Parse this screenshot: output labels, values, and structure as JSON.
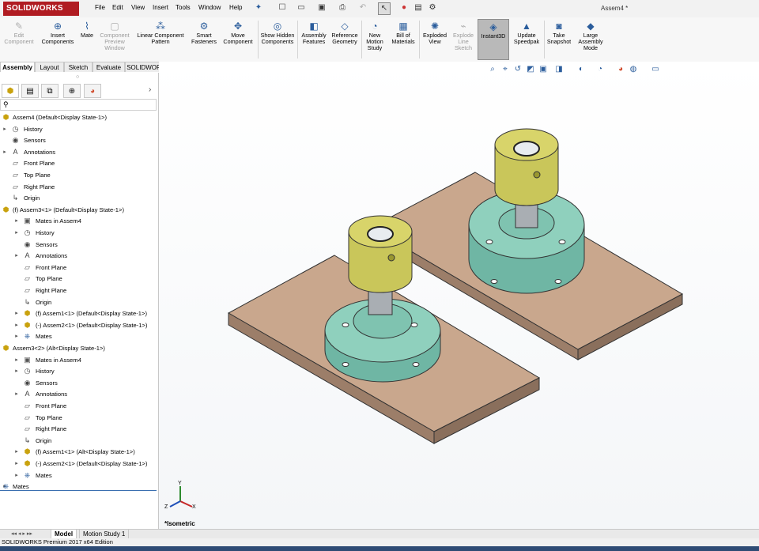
{
  "app": {
    "logo": "SOLIDWORKS",
    "document_title": "Assem4 *"
  },
  "menu": [
    "File",
    "Edit",
    "View",
    "Insert",
    "Tools",
    "Window",
    "Help"
  ],
  "ribbon": {
    "buttons": [
      {
        "id": "edit-component",
        "label": "Edit Component",
        "icon": "pencil-icon",
        "enabled": false
      },
      {
        "id": "insert-components",
        "label": "Insert Components",
        "icon": "insert-component-icon",
        "enabled": true
      },
      {
        "id": "mate",
        "label": "Mate",
        "icon": "paperclip-icon",
        "enabled": true
      },
      {
        "id": "component-preview",
        "label": "Component Preview Window",
        "icon": "preview-window-icon",
        "enabled": false
      },
      {
        "id": "linear-pattern",
        "label": "Linear Component Pattern",
        "icon": "pattern-icon",
        "enabled": true
      },
      {
        "id": "smart-fasteners",
        "label": "Smart Fasteners",
        "icon": "fastener-icon",
        "enabled": true
      },
      {
        "id": "move-component",
        "label": "Move Component",
        "icon": "move-icon",
        "enabled": true
      },
      {
        "id": "show-hidden",
        "label": "Show Hidden Components",
        "icon": "show-hidden-icon",
        "enabled": true
      },
      {
        "id": "assembly-features",
        "label": "Assembly Features",
        "icon": "features-icon",
        "enabled": true
      },
      {
        "id": "reference-geometry",
        "label": "Reference Geometry",
        "icon": "geometry-icon",
        "enabled": true
      },
      {
        "id": "new-motion-study",
        "label": "New Motion Study",
        "icon": "motion-icon",
        "enabled": true
      },
      {
        "id": "bill-of-materials",
        "label": "Bill of Materials",
        "icon": "bom-icon",
        "enabled": true
      },
      {
        "id": "exploded-view",
        "label": "Exploded View",
        "icon": "explode-icon",
        "enabled": true
      },
      {
        "id": "explode-line-sketch",
        "label": "Explode Line Sketch",
        "icon": "explode-line-icon",
        "enabled": false
      },
      {
        "id": "instant3d",
        "label": "Instant3D",
        "icon": "instant3d-icon",
        "enabled": true,
        "active": true
      },
      {
        "id": "update-speedpak",
        "label": "Update Speedpak",
        "icon": "speedpak-icon",
        "enabled": true
      },
      {
        "id": "take-snapshot",
        "label": "Take Snapshot",
        "icon": "camera-icon",
        "enabled": true
      },
      {
        "id": "large-assembly-mode",
        "label": "Large Assembly Mode",
        "icon": "large-assembly-icon",
        "enabled": true
      }
    ]
  },
  "command_tabs": [
    "Assembly",
    "Layout",
    "Sketch",
    "Evaluate",
    "SOLIDWORKS Add-Ins"
  ],
  "tree": [
    {
      "label": "Assem4  (Default<Display State-1>)",
      "icon": "assembly-icon",
      "expander": ""
    },
    {
      "label": "History",
      "icon": "history-icon",
      "expander": "▸"
    },
    {
      "label": "Sensors",
      "icon": "sensor-icon",
      "expander": ""
    },
    {
      "label": "Annotations",
      "icon": "annotation-icon",
      "expander": "▸"
    },
    {
      "label": "Front Plane",
      "icon": "plane-icon",
      "expander": ""
    },
    {
      "label": "Top Plane",
      "icon": "plane-icon",
      "expander": ""
    },
    {
      "label": "Right Plane",
      "icon": "plane-icon",
      "expander": ""
    },
    {
      "label": "Origin",
      "icon": "origin-icon",
      "expander": ""
    },
    {
      "label": "(f) Assem3<1> (Default<Display State-1>)",
      "icon": "subassembly-icon",
      "expander": "▾"
    },
    {
      "label": "Mates in Assem4",
      "icon": "mates-folder-icon",
      "expander": "▸"
    },
    {
      "label": "History",
      "icon": "history-icon",
      "expander": "▸"
    },
    {
      "label": "Sensors",
      "icon": "sensor-icon",
      "expander": ""
    },
    {
      "label": "Annotations",
      "icon": "annotation-icon",
      "expander": "▸"
    },
    {
      "label": "Front Plane",
      "icon": "plane-icon",
      "expander": ""
    },
    {
      "label": "Top Plane",
      "icon": "plane-icon",
      "expander": ""
    },
    {
      "label": "Right Plane",
      "icon": "plane-icon",
      "expander": ""
    },
    {
      "label": "Origin",
      "icon": "origin-icon",
      "expander": ""
    },
    {
      "label": "(f) Assem1<1> (Default<Display State-1>)",
      "icon": "part-icon",
      "expander": "▸"
    },
    {
      "label": "(-) Assem2<1> (Default<Display State-1>)",
      "icon": "part-icon",
      "expander": "▸"
    },
    {
      "label": "Mates",
      "icon": "mates-icon",
      "expander": "▸"
    },
    {
      "label": "Assem3<2> (Alt<Display State-1>)",
      "icon": "subassembly-icon",
      "expander": "▾"
    },
    {
      "label": "Mates in Assem4",
      "icon": "mates-folder-icon",
      "expander": "▸"
    },
    {
      "label": "History",
      "icon": "history-icon",
      "expander": "▸"
    },
    {
      "label": "Sensors",
      "icon": "sensor-icon",
      "expander": ""
    },
    {
      "label": "Annotations",
      "icon": "annotation-icon",
      "expander": "▸"
    },
    {
      "label": "Front Plane",
      "icon": "plane-icon",
      "expander": ""
    },
    {
      "label": "Top Plane",
      "icon": "plane-icon",
      "expander": ""
    },
    {
      "label": "Right Plane",
      "icon": "plane-icon",
      "expander": ""
    },
    {
      "label": "Origin",
      "icon": "origin-icon",
      "expander": ""
    },
    {
      "label": "(f) Assem1<1> (Alt<Display State-1>)",
      "icon": "part-icon",
      "expander": "▸"
    },
    {
      "label": "(-) Assem2<1> (Default<Display State-1>)",
      "icon": "part-icon",
      "expander": "▸"
    },
    {
      "label": "Mates",
      "icon": "mates-icon",
      "expander": "▸"
    },
    {
      "label": "Mates",
      "icon": "mates-icon",
      "expander": "▸"
    }
  ],
  "viewport": {
    "view_label": "*Isometric",
    "axes": {
      "x": "X",
      "y": "Y",
      "z": "Z"
    }
  },
  "bottom_tabs": [
    "Model",
    "Motion Study 1"
  ],
  "status": {
    "text": "SOLIDWORKS Premium 2017 x64 Edition"
  },
  "colors": {
    "brand": "#b01c22",
    "plate": "#c9a78d",
    "cylinder": "#c9c65a",
    "flange": "#8fd0bd",
    "shaft": "#a9aeb3"
  }
}
